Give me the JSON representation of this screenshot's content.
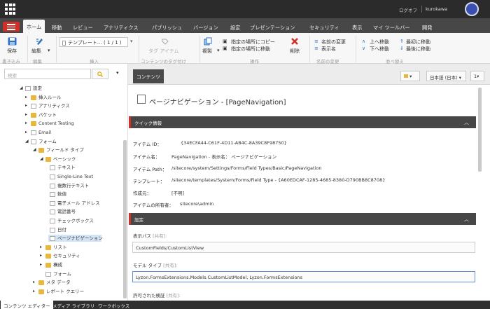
{
  "header": {
    "logoff": "ログオフ",
    "user": "kurokawa"
  },
  "tabs": [
    "ホーム",
    "移動",
    "レビュー",
    "アナリティクス",
    "パブリッシュ",
    "バージョン",
    "設定",
    "プレゼンテーション",
    "セキュリティ",
    "表示",
    "マイ ツールバー",
    "開発"
  ],
  "ribbon": {
    "save": "保存",
    "edit": "編集",
    "template_dropdown": "テンプレート… ( 1 / 1 )",
    "insert_label": "挿入",
    "tag_item": "タグ アイテム",
    "content_tag": "コンテンツのタグ付け",
    "duplicate": "複製",
    "copy_to": "指定の場所にコピー",
    "move_to": "指定の場所に移動",
    "delete": "削除",
    "ops": "操作",
    "rename": "名前の変更",
    "display_name": "表示名",
    "rename_group": "名前の変更",
    "move_up": "上へ移動",
    "move_down": "下へ移動",
    "move_first": "最初に移動",
    "move_last": "最後に移動",
    "sort": "並べ替え",
    "write_group": "書き込み",
    "edit_group": "編集",
    "insert_group": "挿入"
  },
  "search": {
    "placeholder": "検索"
  },
  "tree": [
    {
      "label": "設定",
      "indent": 0,
      "arrow": "▴",
      "icon": "settings-doc"
    },
    {
      "label": "挿入ルール",
      "indent": 1,
      "arrow": "▸",
      "icon": "folder"
    },
    {
      "label": "アナリティクス",
      "indent": 1,
      "arrow": "▸",
      "icon": "chart"
    },
    {
      "label": "バケット",
      "indent": 1,
      "arrow": "▸",
      "icon": "folder"
    },
    {
      "label": "Content Testing",
      "indent": 1,
      "arrow": "▸",
      "icon": "folder"
    },
    {
      "label": "Email",
      "indent": 1,
      "arrow": "▸",
      "icon": "email"
    },
    {
      "label": "フォーム",
      "indent": 1,
      "arrow": "▴",
      "icon": "form"
    },
    {
      "label": "フィールド タイプ",
      "indent": 2,
      "arrow": "▴",
      "icon": "folder"
    },
    {
      "label": "ベーシック",
      "indent": 3,
      "arrow": "▴",
      "icon": "folder"
    },
    {
      "label": "テキスト",
      "indent": 4,
      "arrow": "",
      "icon": "doc"
    },
    {
      "label": "Single-Line Text",
      "indent": 4,
      "arrow": "",
      "icon": "doc"
    },
    {
      "label": "複数行テキスト",
      "indent": 4,
      "arrow": "",
      "icon": "doc"
    },
    {
      "label": "数値",
      "indent": 4,
      "arrow": "",
      "icon": "doc"
    },
    {
      "label": "電子メール アドレス",
      "indent": 4,
      "arrow": "",
      "icon": "doc"
    },
    {
      "label": "電話番号",
      "indent": 4,
      "arrow": "",
      "icon": "doc"
    },
    {
      "label": "チェックボックス",
      "indent": 4,
      "arrow": "",
      "icon": "doc"
    },
    {
      "label": "日付",
      "indent": 4,
      "arrow": "",
      "icon": "doc"
    },
    {
      "label": "ページナビゲーション",
      "indent": 4,
      "arrow": "",
      "icon": "doc",
      "selected": true
    },
    {
      "label": "リスト",
      "indent": 3,
      "arrow": "▸",
      "icon": "folder"
    },
    {
      "label": "セキュリティ",
      "indent": 3,
      "arrow": "▸",
      "icon": "folder"
    },
    {
      "label": "構成",
      "indent": 3,
      "arrow": "▸",
      "icon": "folder"
    },
    {
      "label": "フォーム",
      "indent": 3,
      "arrow": "",
      "icon": "doc"
    },
    {
      "label": "メタ データ",
      "indent": 2,
      "arrow": "▸",
      "icon": "folder"
    },
    {
      "label": "レポート クエリー",
      "indent": 2,
      "arrow": "▸",
      "icon": "folder"
    }
  ],
  "bottom_tabs": [
    "コンテンツ エディター",
    "メディア ライブラリ",
    "ワークボックス"
  ],
  "content_tab": "コンテンツ",
  "lang_button": "日本語 (日本)",
  "version_button": "1",
  "page_title": "ページナビゲーション - [PageNavigation]",
  "quick_info": {
    "title": "クイック情報",
    "rows": [
      {
        "label": "アイテム ID：",
        "value": "{34ECFA44-C61F-4D11-AB4C-8A39C8F98750}"
      },
      {
        "label": "アイテム名：",
        "value": "PageNavigation - 表示名： ページナビゲーション"
      },
      {
        "label": "アイテム Path：",
        "value": "/sitecore/system/Settings/Forms/Field Types/Basic/PageNavigation"
      },
      {
        "label": "テンプレート：",
        "value": "/sitecore/templates/System/Forms/Field Type - {A60EDCAF-1285-4685-8380-D790BB8C8708}"
      },
      {
        "label": "作成元：",
        "value": "[不明]"
      },
      {
        "label": "アイテムの所有者：",
        "value": "sitecore\\admin"
      }
    ]
  },
  "settings_section": {
    "title": "設定",
    "fields": [
      {
        "label": "表示パス",
        "shared": "[共有]:",
        "value": "CustomFields/CustomListView"
      },
      {
        "label": "モデル タイプ",
        "shared": "[共有]:",
        "value": "Lyzon.FormsExtensions.Models.CustomListModel, Lyzon.FormsExtensions"
      },
      {
        "label": "許可された検証",
        "shared": "[共有]:",
        "value": ""
      }
    ]
  }
}
